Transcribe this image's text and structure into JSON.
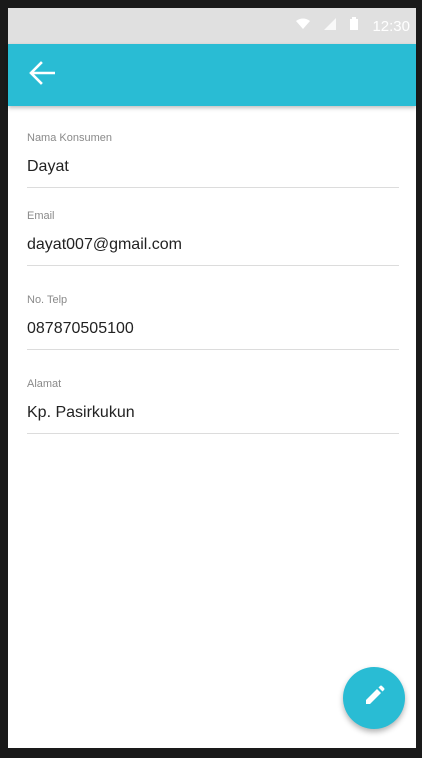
{
  "status_bar": {
    "time": "12:30",
    "icons": [
      "wifi-icon",
      "signal-icon",
      "battery-icon"
    ]
  },
  "app_bar": {
    "back_icon": "arrow-left-icon",
    "color": "#29bcd4"
  },
  "fields": [
    {
      "label": "Nama Konsumen",
      "value": "Dayat"
    },
    {
      "label": "Email",
      "value": "dayat007@gmail.com"
    },
    {
      "label": "No. Telp",
      "value": "087870505100"
    },
    {
      "label": "Alamat",
      "value": "Kp. Pasirkukun"
    }
  ],
  "fab": {
    "icon": "edit-pencil-icon",
    "color": "#29bcd4"
  }
}
